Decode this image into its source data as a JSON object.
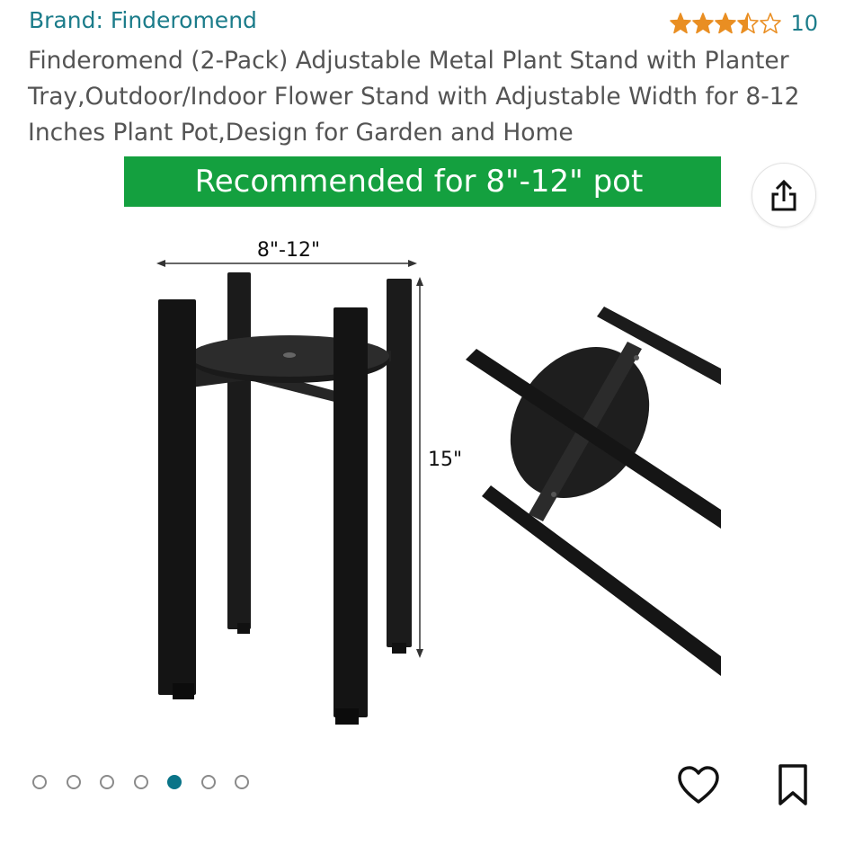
{
  "brand_link": "Brand: Finderomend",
  "rating": {
    "stars": 3.5,
    "count": "10",
    "star_color": "#e98e22"
  },
  "title": "Finderomend (2-Pack) Adjustable Metal Plant Stand with Planter Tray,Outdoor/Indoor Flower Stand with Adjustable Width for 8-12 Inches Plant Pot,Design for Garden and Home",
  "image": {
    "banner_text": "Recommended for 8\"-12\" pot",
    "banner_color": "#14a03f",
    "width_label": "8\"-12\"",
    "height_label": "15\""
  },
  "carousel": {
    "total": 7,
    "active": 4,
    "active_color": "#0a7488"
  },
  "icons": {
    "share": "share-icon",
    "like": "heart-icon",
    "save": "bookmark-icon"
  }
}
